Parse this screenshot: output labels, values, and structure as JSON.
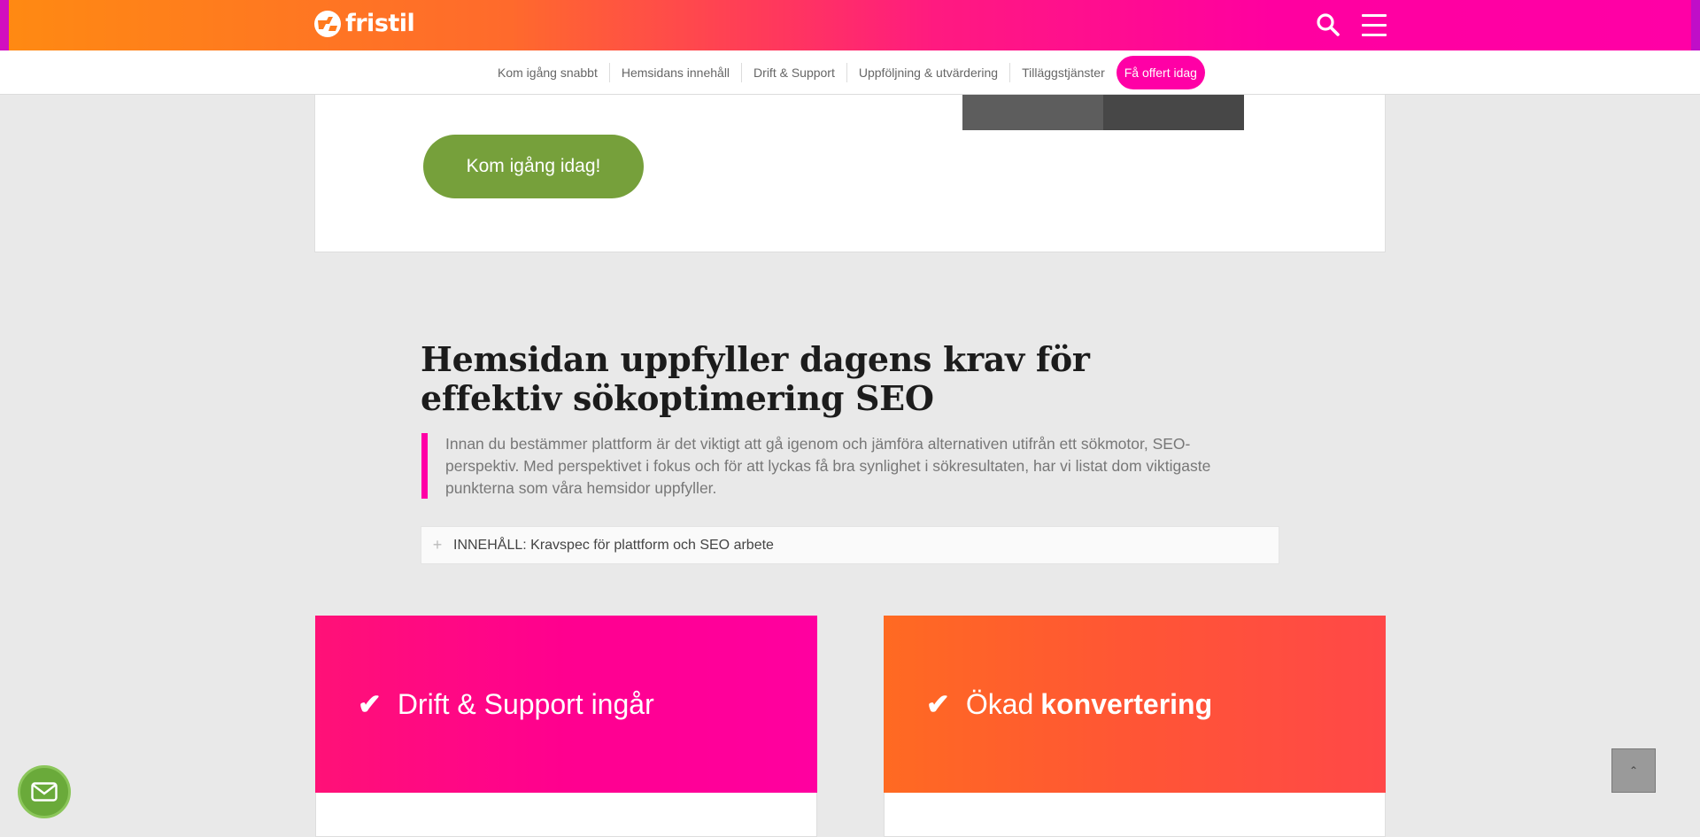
{
  "header": {
    "logo_text": "fristil",
    "icons": {
      "search": "search-icon",
      "menu": "hamburger-menu-icon"
    }
  },
  "subnav": {
    "items": [
      "Kom igång snabbt",
      "Hemsidans innehåll",
      "Drift & Support",
      "Uppföljning & utvärdering",
      "Tilläggstjänster"
    ],
    "cta": "Få offert idag"
  },
  "top_card": {
    "button_label": "Kom igång idag!"
  },
  "section": {
    "title": "Hemsidan uppfyller dagens krav för effektiv sökoptimering SEO",
    "intro": "Innan du bestämmer plattform är det viktigt att gå igenom och jämföra alternativen utifrån ett sökmotor, SEO-perspektiv. Med perspektivet i fokus och för att lyckas få bra synlighet i sökresultaten, har vi listat dom viktigaste punkterna som våra hemsidor uppfyller.",
    "toggle_label": "INNEHÅLL: Kravspec för plattform och SEO arbete"
  },
  "features": [
    {
      "text": "Drift & Support ingår",
      "icon": "checkmark-icon"
    },
    {
      "text": "Ökad",
      "strong": "konvertering",
      "icon": "checkmark-icon"
    }
  ],
  "floating": {
    "mail_icon": "mail-icon",
    "scroll_top_glyph": "⌃"
  },
  "colors": {
    "brand_pink": "#ff00a6",
    "brand_orange": "#ff8a12",
    "button_green": "#76a03b"
  }
}
